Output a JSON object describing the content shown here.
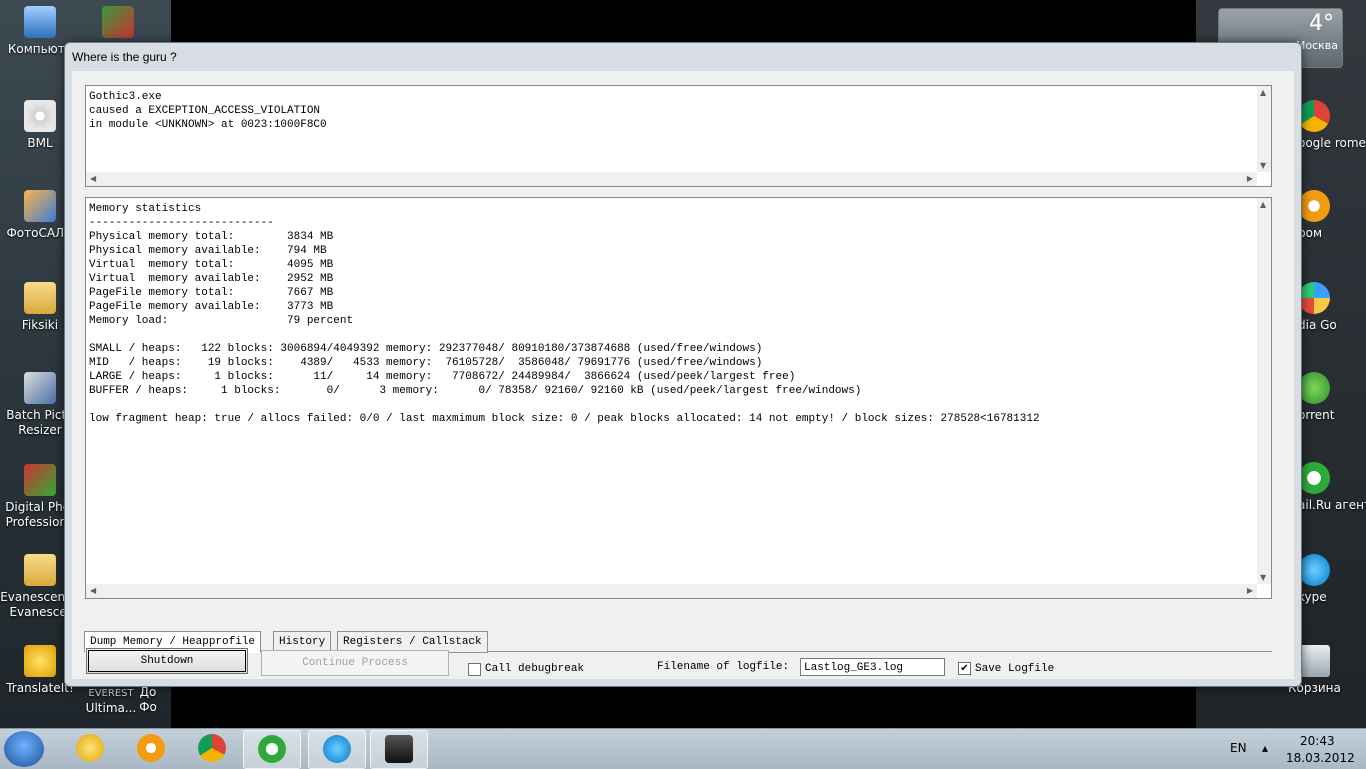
{
  "desktop": {
    "left_icons": [
      {
        "label": "Компьюте"
      },
      {
        "label": "BML"
      },
      {
        "label": "ФотоСАЛО"
      },
      {
        "label": "Fiksiki"
      },
      {
        "label": "Batch Pictu Resizer"
      },
      {
        "label": "Digital Phot Professiona"
      },
      {
        "label": "Evanescenc - Evanesce."
      },
      {
        "label": "TranslateIt!"
      }
    ],
    "right_icons": [
      {
        "label": "oogle rome"
      },
      {
        "label": "ром"
      },
      {
        "label": "dia Go"
      },
      {
        "label": "orrent"
      },
      {
        "label": "ail.Ru агент"
      },
      {
        "label": "kype"
      },
      {
        "label": "Корзина"
      }
    ],
    "partial_labels": [
      "EVEREST",
      "Ultima...",
      "До",
      "Фо"
    ],
    "weather": {
      "temp": "4°",
      "city": "Москва"
    }
  },
  "window": {
    "title": "Where is the guru ?",
    "error_text": "Gothic3.exe\ncaused a EXCEPTION_ACCESS_VIOLATION\nin module <UNKNOWN> at 0023:1000F8C0",
    "stats_text": "Memory statistics\n----------------------------\nPhysical memory total:        3834 MB\nPhysical memory available:    794 MB\nVirtual  memory total:        4095 MB\nVirtual  memory available:    2952 MB\nPageFile memory total:        7667 MB\nPageFile memory available:    3773 MB\nMemory load:                  79 percent\n\nSMALL / heaps:   122 blocks: 3006894/4049392 memory: 292377048/ 80910180/373874688 (used/free/windows)\nMID   / heaps:    19 blocks:    4389/   4533 memory:  76105728/  3586048/ 79691776 (used/free/windows)\nLARGE / heaps:     1 blocks:      11/     14 memory:   7708672/ 24489984/  3866624 (used/peek/largest free)\nBUFFER / heaps:     1 blocks:       0/      3 memory:      0/ 78358/ 92160/ 92160 kB (used/peek/largest free/windows)\n\nlow fragment heap: true / allocs failed: 0/0 / last maxmimum block size: 0 / peak blocks allocated: 14 not empty! / block sizes: 278528<16781312",
    "tabs": [
      "Dump Memory / Heapprofile",
      "History",
      "Registers / Callstack"
    ],
    "active_tab": "Dump Memory / Heapprofile",
    "buttons": {
      "shutdown": "Shutdown",
      "continue": "Continue Process"
    },
    "call_debugbreak": {
      "label": "Call debugbreak",
      "checked": false
    },
    "logfile_label": "Filename of logfile:",
    "logfile_value": "Lastlog_GE3.log",
    "save_logfile": {
      "label": "Save Logfile",
      "checked": true,
      "mark": "✔"
    }
  },
  "taskbar": {
    "language": "EN",
    "time": "20:43",
    "date": "18.03.2012",
    "tray_arrow": "▴"
  }
}
